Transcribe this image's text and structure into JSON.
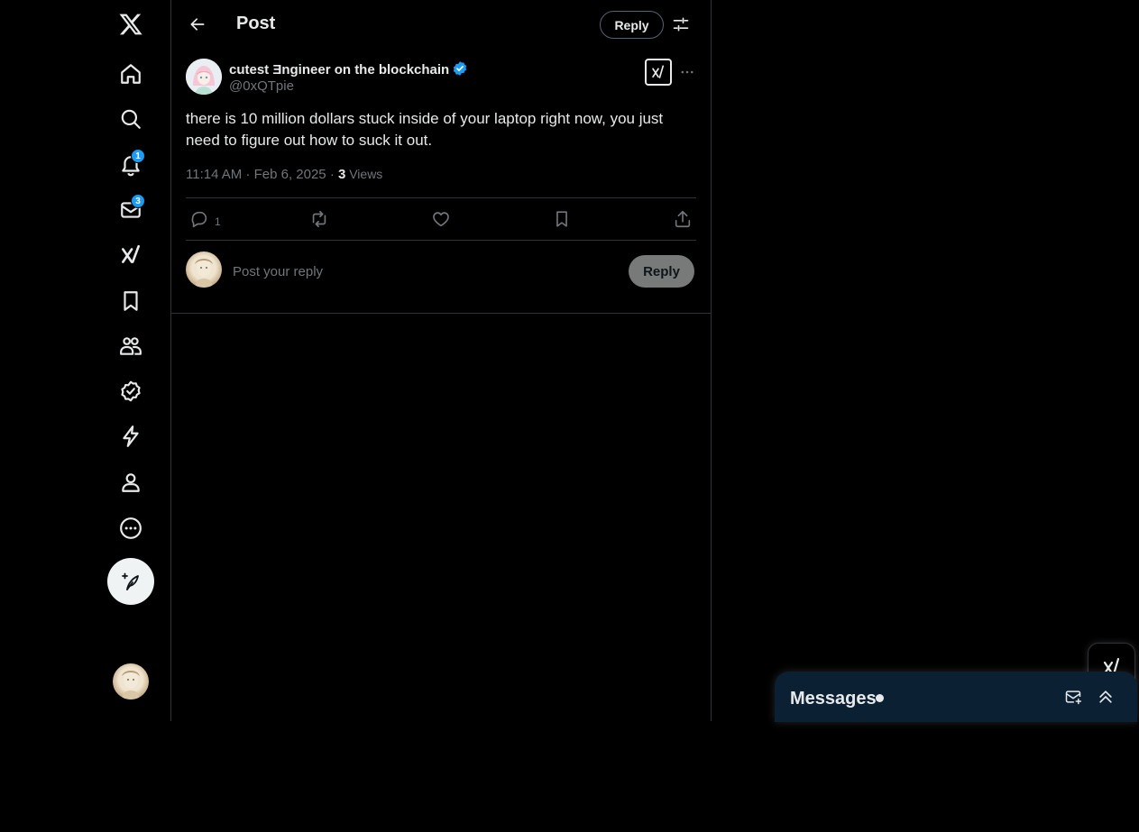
{
  "nav": {
    "items": [
      {
        "name": "x-logo-icon"
      },
      {
        "name": "home-icon"
      },
      {
        "name": "explore-icon"
      },
      {
        "name": "notifications-icon",
        "badge": "1"
      },
      {
        "name": "messages-icon",
        "badge": "3"
      },
      {
        "name": "grok-icon"
      },
      {
        "name": "bookmarks-icon"
      },
      {
        "name": "communities-icon"
      },
      {
        "name": "verified-icon"
      },
      {
        "name": "lightning-icon"
      },
      {
        "name": "profile-icon"
      },
      {
        "name": "more-icon"
      }
    ],
    "notifications_badge": "1",
    "messages_badge": "3"
  },
  "header": {
    "title": "Post",
    "reply_label": "Reply"
  },
  "post": {
    "display_name": "cutest Ǝngineer on the blockchain",
    "handle": "@0xQTpie",
    "text": "there is 10 million dollars stuck inside of your laptop right now, you just need to figure out how to suck it out.",
    "time": "11:14 AM · Feb 6, 2025 · ",
    "views_count": "3",
    "views_label": " Views",
    "reply_count": "1"
  },
  "reply_box": {
    "placeholder": "Post your reply",
    "submit_label": "Reply"
  },
  "messages": {
    "title": "Messages"
  },
  "colors": {
    "accent": "#1d9bf0",
    "background": "#000000",
    "messages_bar": "#0b2033"
  }
}
